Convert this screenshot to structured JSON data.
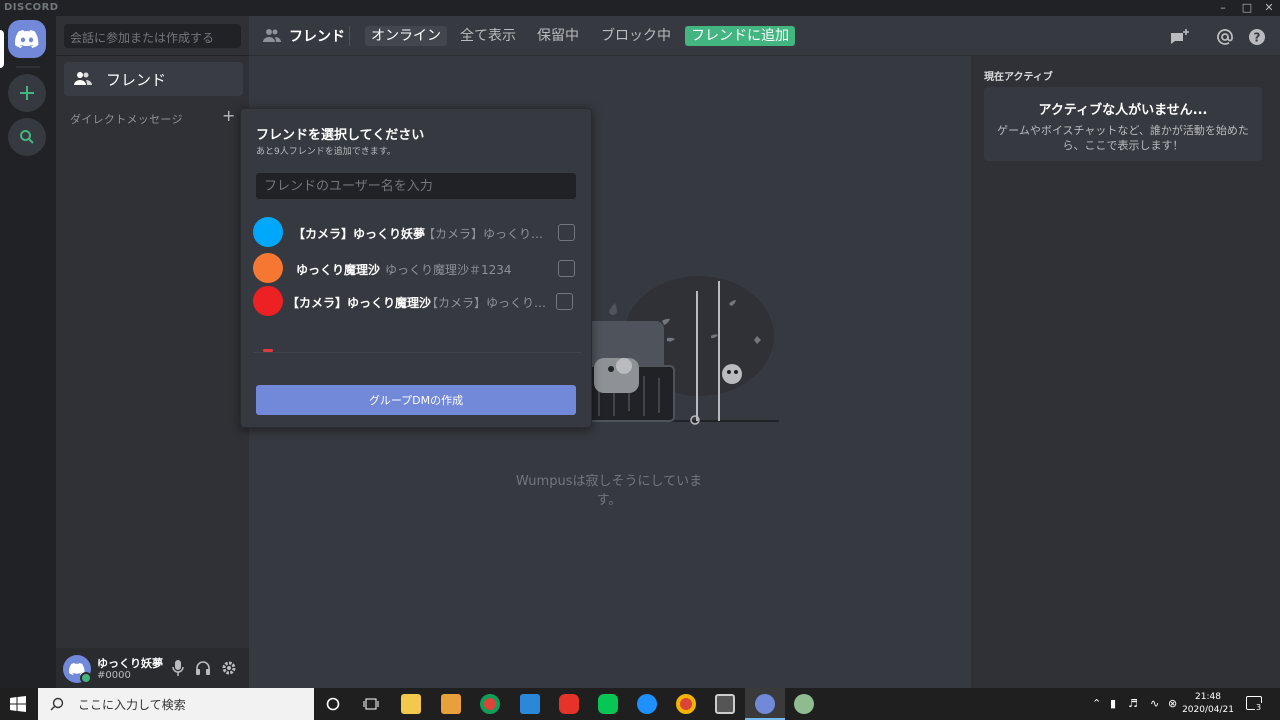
{
  "window": {
    "brand": "DISCORD"
  },
  "channels": {
    "search_placeholder": "会話に参加または作成する",
    "friends_label": "フレンド",
    "dm_header": "ダイレクトメッセージ",
    "dm_add": "+"
  },
  "user": {
    "name": "ゆっくり妖夢",
    "tag": "#0000"
  },
  "topbar": {
    "friends_label": "フレンド",
    "tabs": [
      "オンライン",
      "全て表示",
      "保留中",
      "ブロック中"
    ],
    "add_friend": "フレンドに追加"
  },
  "active_now": {
    "title": "現在アクティブ",
    "card_title": "アクティブな人がいません...",
    "card_text": "ゲームやボイスチャットなど、誰かが活動を始めたら、ここで表示します！"
  },
  "empty": {
    "text": "Wumpusは寂しそうにしています。"
  },
  "popout": {
    "title": "フレンドを選択してください",
    "subtitle": "あと9人フレンドを追加できます。",
    "input_placeholder": "フレンドのユーザー名を入力",
    "friends": [
      {
        "name": "【カメラ】ゆっくり妖夢",
        "user": "【カメラ】ゆっくり妖夢",
        "color": "#00a8fc"
      },
      {
        "name": "ゆっくり魔理沙",
        "user": "ゆっくり魔理沙＃1234",
        "color": "#f57731"
      },
      {
        "name": "【カメラ】ゆっくり魔理沙",
        "user": "【カメラ】ゆっくり魔...",
        "color": "#ed2024"
      }
    ],
    "create_button": "グループDMの作成"
  },
  "taskbar": {
    "search_placeholder": "ここに入力して検索",
    "time": "21:48",
    "date": "2020/04/21",
    "notif_count": "3"
  },
  "colors": {
    "blurple": "#7289da",
    "green": "#43b581"
  }
}
